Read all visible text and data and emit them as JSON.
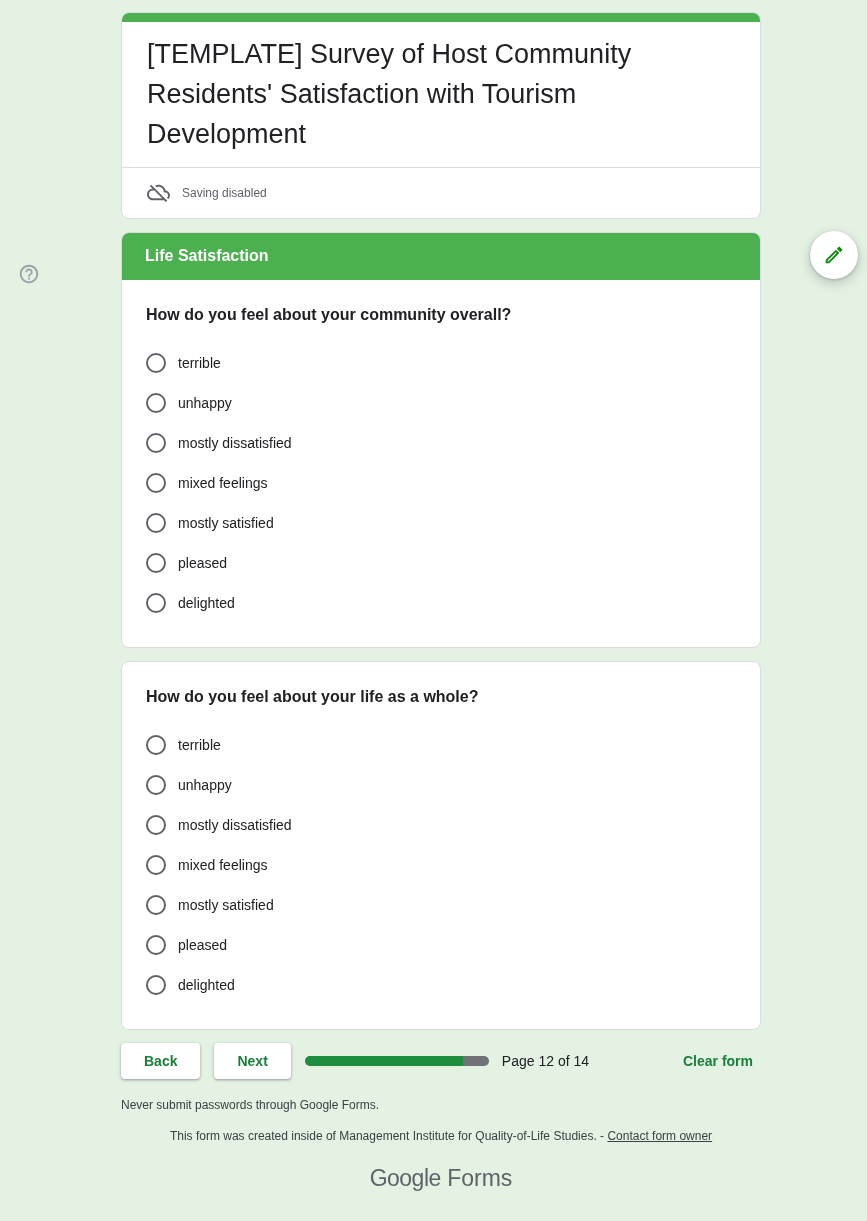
{
  "header": {
    "title": "[TEMPLATE] Survey of Host Community Residents' Satisfaction with Tourism Development",
    "status": "Saving disabled"
  },
  "section": {
    "title": "Life Satisfaction"
  },
  "questions": [
    {
      "text": "How do you feel about your community overall?",
      "options": [
        {
          "label": "terrible",
          "selected": false
        },
        {
          "label": "unhappy",
          "selected": false
        },
        {
          "label": "mostly dissatisfied",
          "selected": false
        },
        {
          "label": "mixed feelings",
          "selected": false
        },
        {
          "label": "mostly satisfied",
          "selected": false
        },
        {
          "label": "pleased",
          "selected": false
        },
        {
          "label": "delighted",
          "selected": false
        }
      ]
    },
    {
      "text": "How do you feel about your life as a whole?",
      "options": [
        {
          "label": "terrible",
          "selected": false
        },
        {
          "label": "unhappy",
          "selected": false
        },
        {
          "label": "mostly dissatisfied",
          "selected": false
        },
        {
          "label": "mixed feelings",
          "selected": false
        },
        {
          "label": "mostly satisfied",
          "selected": false
        },
        {
          "label": "pleased",
          "selected": false
        },
        {
          "label": "delighted",
          "selected": false
        }
      ]
    }
  ],
  "navigation": {
    "buttons": [
      "Back",
      "Next"
    ],
    "progress": {
      "level": 0.86,
      "label": "Page 12 of 14"
    },
    "clear": "Clear form"
  },
  "footer": {
    "warning": "Never submit passwords through Google Forms.",
    "created_by": "This form was created inside of Management Institute for Quality-of-Life Studies. -",
    "contact_link": "Contact form owner",
    "logo": {
      "brand": "Google",
      "product": "Forms"
    }
  }
}
